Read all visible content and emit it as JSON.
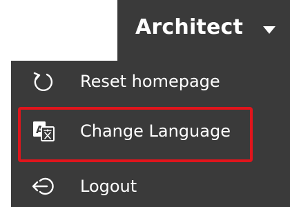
{
  "user_menu": {
    "user_name": "Architect",
    "caret_icon": "chevron-down-icon"
  },
  "menu": {
    "items": [
      {
        "label": "Reset homepage",
        "icon": "reset-icon"
      },
      {
        "label": "Change Language",
        "icon": "translate-icon",
        "highlighted": true
      },
      {
        "label": "Logout",
        "icon": "logout-icon"
      }
    ]
  },
  "colors": {
    "menu_background": "#3a3a3a",
    "text": "#ffffff",
    "highlight_border": "#e0151c",
    "page_background": "#ffffff"
  }
}
